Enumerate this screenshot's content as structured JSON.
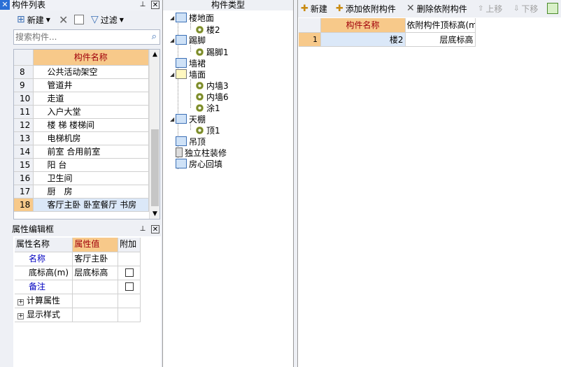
{
  "left_panel": {
    "title": "构件列表",
    "toolbar": {
      "new_label": "新建",
      "filter_label": "过滤"
    },
    "search": {
      "placeholder": "搜索构件..."
    },
    "grid": {
      "header": "构件名称",
      "rows": [
        {
          "num": "8",
          "name": "公共活动架空"
        },
        {
          "num": "9",
          "name": "管道井"
        },
        {
          "num": "10",
          "name": "走道"
        },
        {
          "num": "11",
          "name": "入户大堂"
        },
        {
          "num": "12",
          "name": "楼 梯 楼梯间"
        },
        {
          "num": "13",
          "name": "电梯机房"
        },
        {
          "num": "14",
          "name": "前室 合用前室"
        },
        {
          "num": "15",
          "name": "阳 台"
        },
        {
          "num": "16",
          "name": "卫生间"
        },
        {
          "num": "17",
          "name": "厨　房"
        },
        {
          "num": "18",
          "name": "客厅主卧 卧室餐厅 书房"
        }
      ]
    }
  },
  "props_panel": {
    "title": "属性编辑框",
    "headers": [
      "属性名称",
      "属性值",
      "附加"
    ],
    "rows": [
      {
        "name": "名称",
        "value": "客厅主卧"
      },
      {
        "name": "底标高(m)",
        "value": "层底标高"
      },
      {
        "name": "备注",
        "value": ""
      },
      {
        "name": "计算属性",
        "value": ""
      },
      {
        "name": "显示样式",
        "value": ""
      }
    ]
  },
  "middle_panel": {
    "title": "构件类型",
    "tree": [
      {
        "label": "楼地面",
        "children": [
          "楼2"
        ]
      },
      {
        "label": "踢脚",
        "children": [
          "踢脚1"
        ]
      },
      {
        "label": "墙裙",
        "children": []
      },
      {
        "label": "墙面",
        "children": [
          "内墙3",
          "内墙6",
          "涂1"
        ]
      },
      {
        "label": "天棚",
        "children": [
          "顶1"
        ]
      },
      {
        "label": "吊顶",
        "children": []
      },
      {
        "label": "独立柱装修",
        "children": []
      },
      {
        "label": "房心回填",
        "children": []
      }
    ]
  },
  "right_panel": {
    "toolbar": {
      "new_label": "新建",
      "add_label": "添加依附构件",
      "delete_label": "删除依附构件",
      "up_label": "上移",
      "down_label": "下移"
    },
    "grid": {
      "headers": [
        "构件名称",
        "依附构件顶标高(m"
      ],
      "rows": [
        {
          "num": "1",
          "name": "楼2",
          "height": "层底标高"
        }
      ]
    }
  },
  "colors": {
    "header_orange": "#f7c98a",
    "selected_blue": "#dbe8f8",
    "panel_bg": "#eef0f5",
    "link_blue": "#0000c0"
  }
}
